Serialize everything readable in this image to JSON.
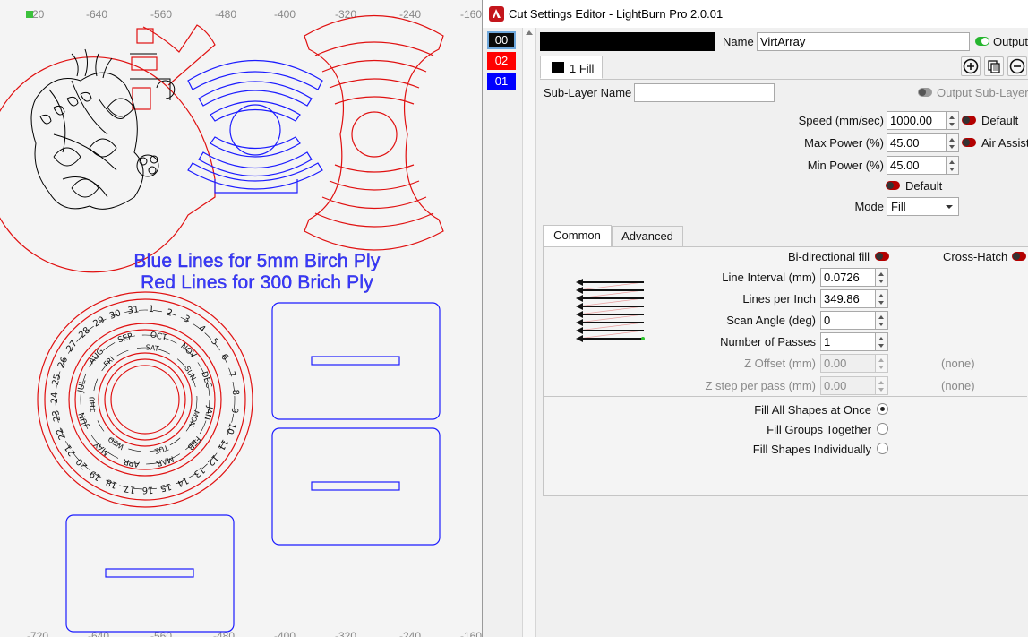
{
  "canvas": {
    "ruler_top": [
      "20",
      "-640",
      "-560",
      "-480",
      "-400",
      "-320",
      "-240",
      "-160"
    ],
    "ruler_bottom": [
      "-720",
      "-640",
      "-560",
      "-480",
      "-400",
      "-320",
      "-240",
      "-160"
    ],
    "text_blue": "Blue Lines for 5mm Birch Ply",
    "text_red": "Red Lines for 300 Brich Ply",
    "calendar_days": [
      "1",
      "2",
      "3",
      "4",
      "5",
      "6",
      "7",
      "8",
      "9",
      "10",
      "11",
      "12",
      "13",
      "14",
      "15",
      "16",
      "17",
      "18",
      "19",
      "20",
      "21",
      "22",
      "23",
      "24",
      "25",
      "26",
      "27",
      "28",
      "29",
      "30",
      "31"
    ],
    "calendar_months": [
      "OCT",
      "NOV",
      "DEC",
      "JAN",
      "FEB",
      "MAR",
      "APR",
      "MAY",
      "JUN",
      "JUL",
      "AUG",
      "SEP"
    ],
    "calendar_weekdays": [
      "SAT",
      "SUN",
      "MON",
      "TUE",
      "WED",
      "THU",
      "FRI"
    ],
    "colors": {
      "blue_lines": "#1b1bff",
      "red_lines": "#e01010",
      "engraving": "#000000"
    }
  },
  "window": {
    "title": "Cut Settings Editor - LightBurn Pro 2.0.01",
    "layers": [
      {
        "label": "00",
        "color": "#0a0a0a"
      },
      {
        "label": "02",
        "color": "#ff0000"
      },
      {
        "label": "01",
        "color": "#0000ff"
      }
    ],
    "name_label": "Name",
    "name_value": "VirtArray",
    "output_label": "Output",
    "sublayer_tab": "1 Fill",
    "sublayer_name_label": "Sub-Layer Name",
    "sublayer_name_value": "",
    "output_sublayer_label": "Output Sub-Layer",
    "speed_label": "Speed (mm/sec)",
    "speed_value": "1000.00",
    "default_label": "Default",
    "max_power_label": "Max Power (%)",
    "max_power_value": "45.00",
    "air_assist_label": "Air Assist",
    "min_power_label": "Min Power (%)",
    "min_power_value": "45.00",
    "default2_label": "Default",
    "mode_label": "Mode",
    "mode_value": "Fill",
    "tabs": {
      "common": "Common",
      "advanced": "Advanced"
    },
    "bidirectional_label": "Bi-directional fill",
    "crosshatch_label": "Cross-Hatch",
    "line_interval_label": "Line Interval (mm)",
    "line_interval_value": "0.0726",
    "lines_per_inch_label": "Lines per Inch",
    "lines_per_inch_value": "349.86",
    "scan_angle_label": "Scan Angle (deg)",
    "scan_angle_value": "0",
    "passes_label": "Number of Passes",
    "passes_value": "1",
    "z_offset_label": "Z Offset (mm)",
    "z_offset_value": "0.00",
    "z_offset_note": "(none)",
    "z_step_label": "Z step per pass (mm)",
    "z_step_value": "0.00",
    "z_step_note": "(none)",
    "fill_options": [
      {
        "label": "Fill All Shapes at Once",
        "checked": true
      },
      {
        "label": "Fill Groups Together",
        "checked": false
      },
      {
        "label": "Fill Shapes Individually",
        "checked": false
      }
    ],
    "icons": {
      "app": "lightburn-icon",
      "add": "plus-circle-icon",
      "copy": "copy-icon",
      "remove": "minus-circle-icon"
    }
  }
}
